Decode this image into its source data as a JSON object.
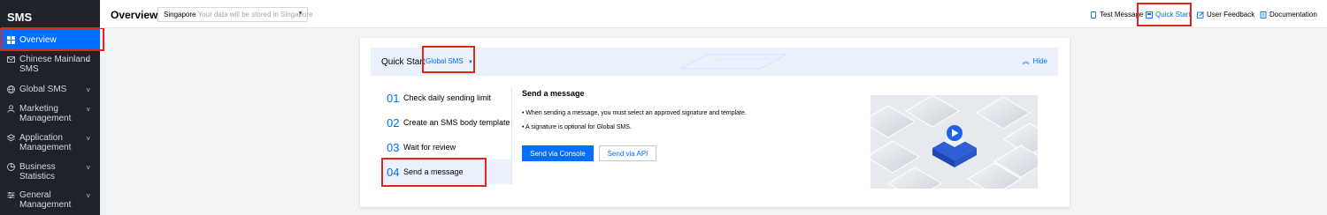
{
  "sidebar": {
    "brand": "SMS",
    "items": [
      {
        "label": "Overview",
        "icon": "grid-icon",
        "active": true
      },
      {
        "label": "Chinese Mainland SMS",
        "line1": "Chinese Mainland",
        "line2": "SMS",
        "icon": "mail-icon"
      },
      {
        "label": "Global SMS",
        "icon": "globe-icon"
      },
      {
        "label": "Marketing Management",
        "line1": "Marketing",
        "line2": "Management",
        "icon": "user-icon"
      },
      {
        "label": "Application Management",
        "line1": "Application",
        "line2": "Management",
        "icon": "layers-icon"
      },
      {
        "label": "Business Statistics",
        "line1": "Business",
        "line2": "Statistics",
        "icon": "pie-icon"
      },
      {
        "label": "General Management",
        "line1": "General",
        "line2": "Management",
        "icon": "sliders-icon"
      }
    ]
  },
  "header": {
    "title": "Overview",
    "region": {
      "value": "Singapore",
      "hint": "Your data will be stored in Singapore"
    },
    "links": {
      "test_message": "Test Message",
      "quick_start": "Quick Start",
      "user_feedback": "User Feedback",
      "documentation": "Documentation"
    }
  },
  "quick_start": {
    "title": "Quick Start",
    "type_selected": "Global SMS",
    "hide": "Hide",
    "steps": [
      {
        "num": "01",
        "label": "Check daily sending limit"
      },
      {
        "num": "02",
        "label": "Create an SMS body template"
      },
      {
        "num": "03",
        "label": "Wait for review"
      },
      {
        "num": "04",
        "label": "Send a message",
        "active": true
      }
    ],
    "detail": {
      "heading": "Send a message",
      "bullets": [
        "When sending a message, you must select an approved signature and template.",
        "A signature is optional for Global SMS."
      ],
      "primary_button": "Send via Console",
      "secondary_button": "Send via API"
    }
  },
  "colors": {
    "accent": "#006eff",
    "sidebar_bg": "#1f2329",
    "highlight_outline": "#e1251b"
  }
}
